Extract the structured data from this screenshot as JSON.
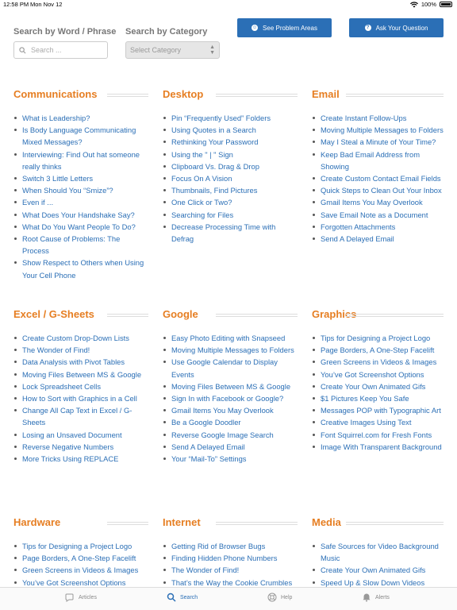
{
  "status": {
    "time": "12:58 PM",
    "date": "Mon Nov 12",
    "battery": "100%"
  },
  "search": {
    "label": "Search by Word / Phrase",
    "placeholder": "Search ..."
  },
  "category": {
    "label": "Search by Category",
    "selected": "Select Category"
  },
  "buttons": {
    "problem_areas": "See Problem Areas",
    "ask_question": "Ask Your Question"
  },
  "colors": {
    "accent": "#e67e22",
    "link": "#2b6fb6",
    "button": "#2b6fb6"
  },
  "sections": [
    {
      "title": "Communications",
      "items": [
        "What is Leadership?",
        "Is Body Language Communicating Mixed Messages?",
        "Interviewing: Find Out hat someone really thinks",
        "Switch 3 Little Letters",
        "When Should You “Smize”?",
        "Even if ...",
        "What Does Your Handshake Say?",
        "What Do You Want People To Do?",
        "Root Cause of Problems: The Process",
        "Show Respect to Others when Using Your Cell Phone"
      ]
    },
    {
      "title": "Desktop",
      "items": [
        "Pin “Frequently Used” Folders",
        "Using Quotes in a Search",
        "Rethinking Your Password",
        "Using the \" | \" Sign",
        "Clipboard Vs. Drag & Drop",
        "Focus On A Vision",
        "Thumbnails, Find Pictures",
        "One Click or Two?",
        "Searching for Files",
        "Decrease Processing Time with Defrag"
      ]
    },
    {
      "title": "Email",
      "items": [
        "Create Instant Follow-Ups",
        "Moving Multiple Messages to Folders",
        "May I Steal a Minute of Your Time?",
        "Keep Bad Email Address from Showing",
        "Create Custom Contact Email Fields",
        "Quick Steps to Clean Out Your Inbox",
        "Gmail Items You May Overlook",
        "Save Email Note as a Document",
        "Forgotten Attachments",
        "Send A Delayed Email"
      ]
    },
    {
      "title": "Excel / G-Sheets",
      "items": [
        "Create Custom Drop-Down Lists",
        "The Wonder of Find!",
        "Data Analysis with Pivot Tables",
        "Moving Files Between MS & Google",
        "Lock Spreadsheet Cells",
        "How to Sort with Graphics in a Cell",
        "Change All Cap Text in Excel / G-Sheets",
        "Losing an Unsaved Document",
        "Reverse Negative Numbers",
        "More Tricks Using REPLACE"
      ]
    },
    {
      "title": "Google",
      "items": [
        "Easy Photo Editing with Snapseed",
        "Moving Multiple Messages to Folders",
        "Use Google Calendar to Display Events",
        "Moving Files Between MS & Google",
        "Sign In with Facebook or Google?",
        "Gmail Items You May Overlook",
        "Be a Google Doodler",
        "Reverse Google Image Search",
        "Send A Delayed Email",
        "Your “Mail-To” Settings"
      ]
    },
    {
      "title": "Graphics",
      "items": [
        "Tips for Designing a Project Logo",
        "Page Borders, A One-Step Facelift",
        "Green Screens in Videos & Images",
        "You’ve Got Screenshot Options",
        "Create Your Own Animated Gifs",
        "$1 Pictures Keep You Safe",
        "Messages POP with Typographic Art",
        "Creative Images Using Text",
        "Font Squirrel.com for Fresh Fonts",
        "Image With Transparent Background"
      ]
    },
    {
      "title": "Hardware",
      "items": [
        "Tips for Designing a Project Logo",
        "Page Borders, A One-Step Facelift",
        "Green Screens in Videos & Images",
        "You’ve Got Screenshot Options"
      ]
    },
    {
      "title": "Internet",
      "items": [
        "Getting Rid of Browser Bugs",
        "Finding Hidden Phone Numbers",
        "The Wonder of Find!",
        "That’s the Way the Cookie Crumbles"
      ]
    },
    {
      "title": "Media",
      "items": [
        "Safe Sources for Video Background Music",
        "Create Your Own Animated Gifs",
        "Speed Up & Slow Down Videos"
      ]
    }
  ],
  "tabs": [
    {
      "label": "Articles",
      "icon": "articles-icon"
    },
    {
      "label": "Search",
      "icon": "search-icon"
    },
    {
      "label": "Help",
      "icon": "help-icon"
    },
    {
      "label": "Alerts",
      "icon": "bell-icon"
    }
  ]
}
